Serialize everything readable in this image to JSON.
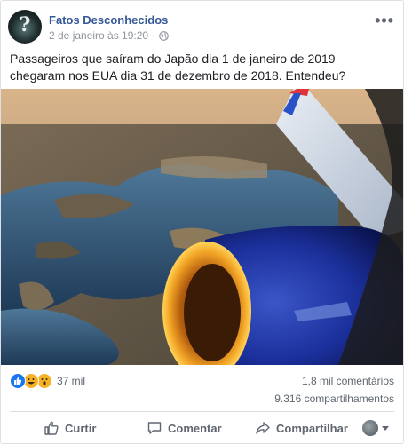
{
  "post": {
    "author": "Fatos Desconhecidos",
    "timestamp": "2 de janeiro às 19:20",
    "privacy_icon": "globe-icon",
    "more_icon": "•••",
    "text": "Passageiros que saíram do Japão dia 1 de janeiro de 2019 chegaram nos EUA dia 31 de dezembro de 2018. Entendeu?"
  },
  "engagement": {
    "reaction_icons": [
      "like",
      "haha",
      "wow"
    ],
    "reaction_count": "37 mil",
    "comments": "1,8 mil comentários",
    "shares": "9.316 compartilhamentos"
  },
  "actions": {
    "like_label": "Curtir",
    "comment_label": "Comentar",
    "share_label": "Compartilhar"
  },
  "colors": {
    "author_link": "#365899",
    "secondary_text": "#606770",
    "like_blue": "#1877f2"
  }
}
